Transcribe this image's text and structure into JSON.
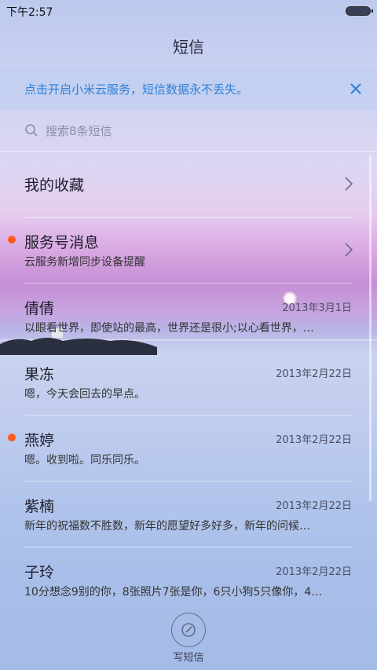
{
  "status_bar": {
    "time": "下午2:57"
  },
  "header": {
    "title": "短信"
  },
  "banner": {
    "text": "点击开启小米云服务，短信数据永不丢失。"
  },
  "search": {
    "placeholder": "搜索8条短信"
  },
  "conversations": [
    {
      "name": "我的收藏",
      "snippet": "",
      "date": "",
      "unread": false,
      "has_chevron": true
    },
    {
      "name": "服务号消息",
      "snippet": "云服务新增同步设备提醒",
      "date": "",
      "unread": true,
      "has_chevron": true
    },
    {
      "name": "倩倩",
      "snippet": "以眼看世界，即使站的最高，世界还是很小;以心看世界，…",
      "date": "2013年3月1日",
      "unread": false,
      "has_chevron": false
    },
    {
      "name": "果冻",
      "snippet": "嗯，今天会回去的早点。",
      "date": "2013年2月22日",
      "unread": false,
      "has_chevron": false
    },
    {
      "name": "燕婷",
      "snippet": "嗯。收到啦。同乐同乐。",
      "date": "2013年2月22日",
      "unread": true,
      "has_chevron": false
    },
    {
      "name": "紫楠",
      "snippet": "新年的祝福数不胜数，新年的愿望好多好多，新年的问候…",
      "date": "2013年2月22日",
      "unread": false,
      "has_chevron": false
    },
    {
      "name": "子玲",
      "snippet": "10分想念9别的你，8张照片7张是你，6只小狗5只像你，4…",
      "date": "2013年2月22日",
      "unread": false,
      "has_chevron": false
    }
  ],
  "compose": {
    "label": "写短信"
  },
  "icons": {
    "close": "close-icon",
    "search": "search-icon",
    "chevron": "chevron-right-icon",
    "compose": "compose-icon",
    "battery": "battery-icon",
    "unread_dot": "unread-dot-icon"
  },
  "colors": {
    "accent_blue": "#2d7fd8",
    "unread_orange": "#ff5a1f"
  }
}
